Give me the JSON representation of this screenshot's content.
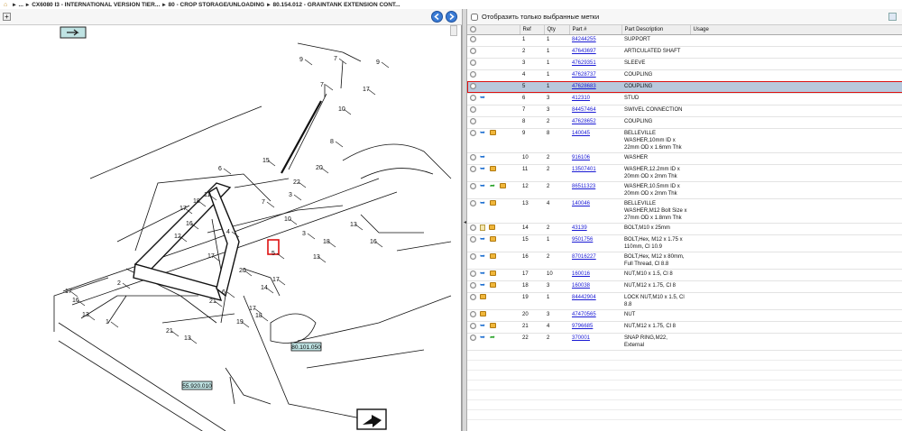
{
  "breadcrumb": {
    "items": [
      "...",
      "CX6080 I3 - INTERNATIONAL VERSION TIER...",
      "80 - CROP STORAGE/UNLOADING",
      "80.154.012 - GRAINTANK EXTENSION CONT..."
    ]
  },
  "diagram": {
    "callouts": [
      {
        "label": "7"
      },
      {
        "label": "9"
      },
      {
        "label": "17"
      },
      {
        "label": "7"
      },
      {
        "label": "10"
      },
      {
        "label": "8"
      },
      {
        "label": "15"
      },
      {
        "label": "20"
      },
      {
        "label": "22"
      },
      {
        "label": "3"
      },
      {
        "label": "10"
      },
      {
        "label": "13"
      },
      {
        "label": "6"
      },
      {
        "label": "11"
      },
      {
        "label": "18"
      },
      {
        "label": "17"
      },
      {
        "label": "16"
      },
      {
        "label": "12"
      },
      {
        "label": "2"
      },
      {
        "label": "4"
      },
      {
        "label": "1"
      },
      {
        "label": "5"
      },
      {
        "label": "14"
      },
      {
        "label": "17"
      },
      {
        "label": "20"
      },
      {
        "label": "17"
      },
      {
        "label": "18"
      },
      {
        "label": "19"
      },
      {
        "label": "21"
      },
      {
        "label": "13"
      },
      {
        "label": "3"
      },
      {
        "label": "6"
      },
      {
        "label": "17"
      },
      {
        "label": "16"
      },
      {
        "label": "13"
      },
      {
        "label": "21"
      },
      {
        "label": "17"
      },
      {
        "label": "7"
      },
      {
        "label": "9"
      },
      {
        "label": "16"
      },
      {
        "label": "18"
      },
      {
        "label": "13"
      }
    ],
    "ref_tags": [
      "80.101.050",
      "55.920.010"
    ]
  },
  "parts_panel": {
    "filter_label": "Отобразить только выбранные метки",
    "columns": [
      "Ref",
      "Qty",
      "Part #",
      "Part Description",
      "Usage"
    ],
    "rows": [
      {
        "ref": "1",
        "qty": "1",
        "part": "84244255",
        "desc": "SUPPORT",
        "icons": []
      },
      {
        "ref": "2",
        "qty": "1",
        "part": "47643697",
        "desc": "ARTICULATED SHAFT",
        "icons": []
      },
      {
        "ref": "3",
        "qty": "1",
        "part": "47629351",
        "desc": "SLEEVE",
        "icons": []
      },
      {
        "ref": "4",
        "qty": "1",
        "part": "47628737",
        "desc": "COUPLING",
        "icons": []
      },
      {
        "ref": "5",
        "qty": "1",
        "part": "47628683",
        "desc": "COUPLING",
        "icons": [],
        "selected": true
      },
      {
        "ref": "6",
        "qty": "3",
        "part": "412310",
        "desc": "STUD",
        "icons": [
          "blue"
        ]
      },
      {
        "ref": "7",
        "qty": "3",
        "part": "84457464",
        "desc": "SWIVEL CONNECTION",
        "icons": []
      },
      {
        "ref": "8",
        "qty": "2",
        "part": "47628652",
        "desc": "COUPLING",
        "icons": []
      },
      {
        "ref": "9",
        "qty": "8",
        "part": "140045",
        "desc": "BELLEVILLE WASHER,10mm ID x 22mm OD x 1.6mm Thk",
        "icons": [
          "blue",
          "box"
        ]
      },
      {
        "ref": "10",
        "qty": "2",
        "part": "916106",
        "desc": "WASHER",
        "icons": [
          "blue"
        ]
      },
      {
        "ref": "11",
        "qty": "2",
        "part": "13507401",
        "desc": "WASHER,12.2mm ID x 20mm OD x 2mm Thk",
        "icons": [
          "blue",
          "box"
        ]
      },
      {
        "ref": "12",
        "qty": "2",
        "part": "86511323",
        "desc": "WASHER,10.5mm ID x 20mm OD x 2mm Thk",
        "icons": [
          "blue",
          "green",
          "box"
        ]
      },
      {
        "ref": "13",
        "qty": "4",
        "part": "140046",
        "desc": "BELLEVILLE WASHER,M12 Bolt Size x 27mm OD x 1.8mm Thk",
        "icons": [
          "blue",
          "box"
        ]
      },
      {
        "ref": "14",
        "qty": "2",
        "part": "43139",
        "desc": "BOLT,M10 x 25mm",
        "icons": [
          "page",
          "box"
        ]
      },
      {
        "ref": "15",
        "qty": "1",
        "part": "9501756",
        "desc": "BOLT,Hex, M12 x 1.75 x 110mm, Cl 10.9",
        "icons": [
          "blue",
          "box"
        ]
      },
      {
        "ref": "16",
        "qty": "2",
        "part": "87016227",
        "desc": "BOLT,Hex, M12 x 80mm, Full Thread, Cl 8.8",
        "icons": [
          "blue",
          "box"
        ]
      },
      {
        "ref": "17",
        "qty": "10",
        "part": "160016",
        "desc": "NUT,M10 x 1.5, Cl 8",
        "icons": [
          "blue",
          "box"
        ]
      },
      {
        "ref": "18",
        "qty": "3",
        "part": "160038",
        "desc": "NUT,M12 x 1.75, Cl 8",
        "icons": [
          "blue",
          "box"
        ]
      },
      {
        "ref": "19",
        "qty": "1",
        "part": "84442904",
        "desc": "LOCK NUT,M10 x 1.5, Cl 8.8",
        "icons": [
          "box"
        ]
      },
      {
        "ref": "20",
        "qty": "3",
        "part": "47470565",
        "desc": "NUT",
        "icons": [
          "box"
        ]
      },
      {
        "ref": "21",
        "qty": "4",
        "part": "9796685",
        "desc": "NUT,M12 x 1.75, Cl 8",
        "icons": [
          "blue",
          "box"
        ]
      },
      {
        "ref": "22",
        "qty": "2",
        "part": "370001",
        "desc": "SNAP RING,M22, External",
        "icons": [
          "blue",
          "green"
        ]
      }
    ]
  },
  "colors": {
    "selection": "#b8c8dc",
    "highlight_border": "#d11111",
    "link": "#1a1ad4",
    "tag_bg": "#bfe3e3"
  }
}
